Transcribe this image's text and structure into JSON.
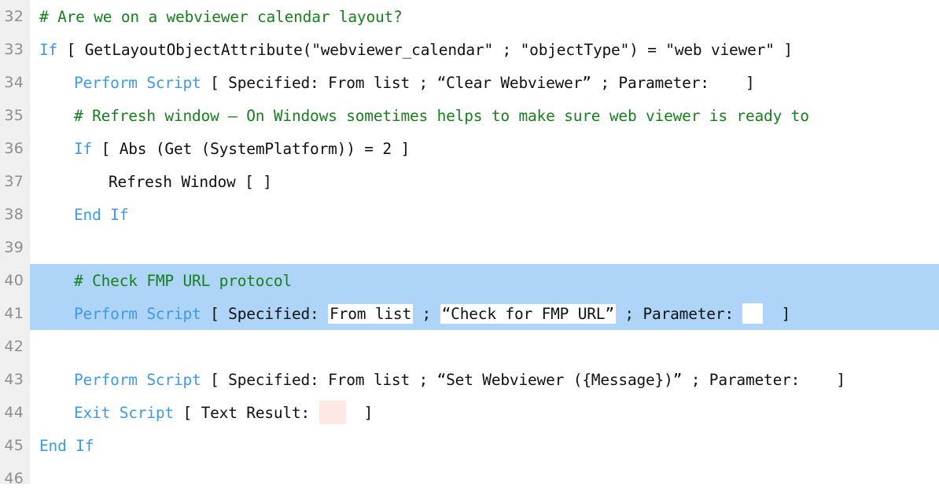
{
  "editor": {
    "title": "FileMaker Script Workspace",
    "colors": {
      "background": "#ffffff",
      "gutter": "#f0f0f0",
      "line_number": "#8e8e8e",
      "comment": "#17801c",
      "keyword": "#3d9ae8",
      "plain_text": "#111111",
      "selection_highlight": "#aed4f7",
      "chip_background": "#ffffff",
      "chip_pink": "#fde8e3"
    },
    "selected_lines": [
      40,
      41
    ]
  },
  "lines": [
    {
      "number": "32",
      "indent": 1,
      "highlighted": false,
      "text": "# Are we on a webviewer calendar layout?",
      "tokens": [
        {
          "kind": "comment",
          "text": "# Are we on a webviewer calendar layout?"
        }
      ]
    },
    {
      "number": "33",
      "indent": 1,
      "highlighted": false,
      "text": "If [ GetLayoutObjectAttribute(\"webviewer_calendar\" ; \"objectType\") = \"web viewer\" ]",
      "tokens": [
        {
          "kind": "keyword",
          "text": "If"
        },
        {
          "kind": "plain",
          "text": " [ GetLayoutObjectAttribute(\"webviewer_calendar\" ; \"objectType\") = \"web viewer\" ]"
        }
      ]
    },
    {
      "number": "34",
      "indent": 2,
      "highlighted": false,
      "text": "Perform Script [ Specified: From list ; “Clear Webviewer” ; Parameter:    ]",
      "tokens": [
        {
          "kind": "keyword",
          "text": "Perform Script"
        },
        {
          "kind": "plain",
          "text": " [ Specified: From list ; “Clear Webviewer” ; Parameter:    ]"
        }
      ]
    },
    {
      "number": "35",
      "indent": 2,
      "highlighted": false,
      "text": "# Refresh window — On Windows sometimes helps to make sure web viewer is ready to",
      "tokens": [
        {
          "kind": "comment",
          "text": "# Refresh window — On Windows sometimes helps to make sure web viewer is ready to"
        }
      ]
    },
    {
      "number": "36",
      "indent": 2,
      "highlighted": false,
      "text": "If [ Abs (Get (SystemPlatform)) = 2 ]",
      "tokens": [
        {
          "kind": "keyword",
          "text": "If"
        },
        {
          "kind": "plain",
          "text": " [ Abs (Get (SystemPlatform)) = 2 ]"
        }
      ]
    },
    {
      "number": "37",
      "indent": 3,
      "highlighted": false,
      "text": "Refresh Window [ ]",
      "tokens": [
        {
          "kind": "plain",
          "text": "Refresh Window [ ]"
        }
      ]
    },
    {
      "number": "38",
      "indent": 2,
      "highlighted": false,
      "text": "End If",
      "tokens": [
        {
          "kind": "keyword",
          "text": "End If"
        }
      ]
    },
    {
      "number": "39",
      "indent": 1,
      "highlighted": false,
      "text": "",
      "tokens": []
    },
    {
      "number": "40",
      "indent": 2,
      "highlighted": true,
      "text": "# Check FMP URL protocol",
      "tokens": [
        {
          "kind": "comment",
          "text": "# Check FMP URL protocol"
        }
      ]
    },
    {
      "number": "41",
      "indent": 2,
      "highlighted": true,
      "text": "Perform Script [ Specified: From list ; “Check for FMP URL” ; Parameter:   ]",
      "tokens": [
        {
          "kind": "keyword",
          "text": "Perform Script"
        },
        {
          "kind": "plain",
          "text": " [ Specified: "
        },
        {
          "kind": "chip",
          "text": "From list"
        },
        {
          "kind": "plain",
          "text": " ; "
        },
        {
          "kind": "chip",
          "text": "“Check for FMP URL”"
        },
        {
          "kind": "plain",
          "text": " ; Parameter: "
        },
        {
          "kind": "chip-empty",
          "text": ""
        },
        {
          "kind": "plain",
          "text": "  ]"
        }
      ]
    },
    {
      "number": "42",
      "indent": 1,
      "highlighted": false,
      "text": "",
      "tokens": []
    },
    {
      "number": "43",
      "indent": 2,
      "highlighted": false,
      "text": "Perform Script [ Specified: From list ; “Set Webviewer ({Message})” ; Parameter:    ]",
      "tokens": [
        {
          "kind": "keyword",
          "text": "Perform Script"
        },
        {
          "kind": "plain",
          "text": " [ Specified: From list ; “Set Webviewer ({Message})” ; Parameter:    ]"
        }
      ]
    },
    {
      "number": "44",
      "indent": 2,
      "highlighted": false,
      "text": "Exit Script [ Text Result:   ]",
      "tokens": [
        {
          "kind": "keyword",
          "text": "Exit Script"
        },
        {
          "kind": "plain",
          "text": " [ Text Result: "
        },
        {
          "kind": "chip-pink",
          "text": ""
        },
        {
          "kind": "plain",
          "text": "  ]"
        }
      ]
    },
    {
      "number": "45",
      "indent": 1,
      "highlighted": false,
      "text": "End If",
      "tokens": [
        {
          "kind": "keyword",
          "text": "End If"
        }
      ]
    },
    {
      "number": "46",
      "indent": 1,
      "highlighted": false,
      "text": "",
      "tokens": []
    }
  ]
}
